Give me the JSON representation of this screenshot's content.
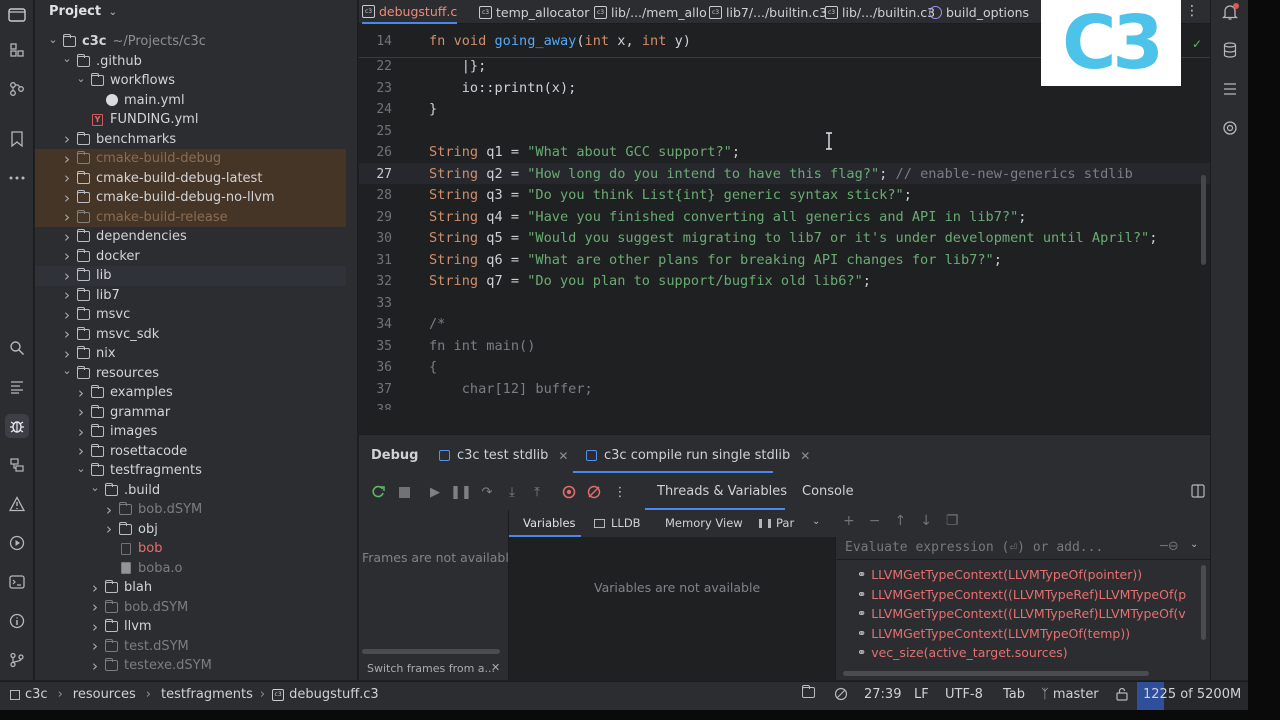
{
  "project_panel": {
    "title": "Project",
    "tree": [
      {
        "label": "c3c",
        "suffix": "~/Projects/c3c",
        "level": 0,
        "chev": "down",
        "icon": "folder"
      },
      {
        "label": ".github",
        "level": 1,
        "chev": "down",
        "icon": "folder"
      },
      {
        "label": "workflows",
        "level": 2,
        "chev": "down",
        "icon": "folder"
      },
      {
        "label": "main.yml",
        "level": 3,
        "chev": "none",
        "icon": "github"
      },
      {
        "label": "FUNDING.yml",
        "level": 2,
        "chev": "none",
        "icon": "yml"
      },
      {
        "label": "benchmarks",
        "level": 1,
        "chev": "right",
        "icon": "folder"
      },
      {
        "label": "cmake-build-debug",
        "level": 1,
        "chev": "right",
        "icon": "folder",
        "style": "excluded-dim"
      },
      {
        "label": "cmake-build-debug-latest",
        "level": 1,
        "chev": "right",
        "icon": "folder",
        "style": "excluded"
      },
      {
        "label": "cmake-build-debug-no-llvm",
        "level": 1,
        "chev": "right",
        "icon": "folder",
        "style": "excluded"
      },
      {
        "label": "cmake-build-release",
        "level": 1,
        "chev": "right",
        "icon": "folder",
        "style": "excluded-dim"
      },
      {
        "label": "dependencies",
        "level": 1,
        "chev": "right",
        "icon": "folder"
      },
      {
        "label": "docker",
        "level": 1,
        "chev": "right",
        "icon": "folder"
      },
      {
        "label": "lib",
        "level": 1,
        "chev": "right",
        "icon": "folder",
        "style": "selected"
      },
      {
        "label": "lib7",
        "level": 1,
        "chev": "right",
        "icon": "folder"
      },
      {
        "label": "msvc",
        "level": 1,
        "chev": "right",
        "icon": "folder"
      },
      {
        "label": "msvc_sdk",
        "level": 1,
        "chev": "right",
        "icon": "folder"
      },
      {
        "label": "nix",
        "level": 1,
        "chev": "right",
        "icon": "folder"
      },
      {
        "label": "resources",
        "level": 1,
        "chev": "down",
        "icon": "folder"
      },
      {
        "label": "examples",
        "level": 2,
        "chev": "right",
        "icon": "folder"
      },
      {
        "label": "grammar",
        "level": 2,
        "chev": "right",
        "icon": "folder"
      },
      {
        "label": "images",
        "level": 2,
        "chev": "right",
        "icon": "folder"
      },
      {
        "label": "rosettacode",
        "level": 2,
        "chev": "right",
        "icon": "folder"
      },
      {
        "label": "testfragments",
        "level": 2,
        "chev": "down",
        "icon": "folder"
      },
      {
        "label": ".build",
        "level": 3,
        "chev": "down",
        "icon": "folder"
      },
      {
        "label": "bob.dSYM",
        "level": 4,
        "chev": "right",
        "icon": "folder",
        "style": "dim"
      },
      {
        "label": "obj",
        "level": 4,
        "chev": "right",
        "icon": "folder"
      },
      {
        "label": "bob",
        "level": 4,
        "chev": "none",
        "icon": "binary",
        "style": "red"
      },
      {
        "label": "boba.o",
        "level": 4,
        "chev": "none",
        "icon": "file",
        "style": "dim"
      },
      {
        "label": "blah",
        "level": 3,
        "chev": "right",
        "icon": "folder"
      },
      {
        "label": "bob.dSYM",
        "level": 3,
        "chev": "right",
        "icon": "folder",
        "style": "dim"
      },
      {
        "label": "llvm",
        "level": 3,
        "chev": "right",
        "icon": "folder"
      },
      {
        "label": "test.dSYM",
        "level": 3,
        "chev": "right",
        "icon": "folder",
        "style": "dim"
      },
      {
        "label": "testexe.dSYM",
        "level": 3,
        "chev": "right",
        "icon": "folder",
        "style": "dim"
      }
    ]
  },
  "tabs": [
    {
      "label": "debugstuff.c",
      "active": true
    },
    {
      "label": "temp_allocator"
    },
    {
      "label": "lib/.../mem_allo"
    },
    {
      "label": "lib7/.../builtin.c3"
    },
    {
      "label": "lib/.../builtin.c3"
    },
    {
      "label": "build_options"
    }
  ],
  "editor": {
    "sticky": {
      "line": "14",
      "tokens": [
        [
          "kw",
          "fn "
        ],
        [
          "kw",
          "void "
        ],
        [
          "fn",
          "going_away"
        ],
        [
          "t",
          "("
        ],
        [
          "kw",
          "int "
        ],
        [
          "t",
          "x, "
        ],
        [
          "kw",
          "int "
        ],
        [
          "t",
          "y)"
        ]
      ]
    },
    "lines": [
      {
        "n": "22",
        "tokens": [
          [
            "t",
            "    |};"
          ]
        ]
      },
      {
        "n": "23",
        "tokens": [
          [
            "t",
            "    io::printn(x);"
          ]
        ]
      },
      {
        "n": "24",
        "tokens": [
          [
            "t",
            "}"
          ]
        ]
      },
      {
        "n": "25",
        "tokens": []
      },
      {
        "n": "26",
        "tokens": [
          [
            "kw",
            "String "
          ],
          [
            "t",
            "q1 = "
          ],
          [
            "str",
            "\"What about GCC support?\""
          ],
          [
            "t",
            ";"
          ]
        ]
      },
      {
        "n": "27",
        "current": true,
        "tokens": [
          [
            "kw",
            "String "
          ],
          [
            "t",
            "q2 = "
          ],
          [
            "str",
            "\"How long do you intend to have this flag?\""
          ],
          [
            "t",
            "; "
          ],
          [
            "cmt",
            "// enable-new-generics stdlib"
          ]
        ]
      },
      {
        "n": "28",
        "tokens": [
          [
            "kw",
            "String "
          ],
          [
            "t",
            "q3 = "
          ],
          [
            "str",
            "\"Do you think List{int} generic syntax stick?\""
          ],
          [
            "t",
            ";"
          ]
        ]
      },
      {
        "n": "29",
        "tokens": [
          [
            "kw",
            "String "
          ],
          [
            "t",
            "q4 = "
          ],
          [
            "str",
            "\"Have you finished converting all generics and API in lib7?\""
          ],
          [
            "t",
            ";"
          ]
        ]
      },
      {
        "n": "30",
        "tokens": [
          [
            "kw",
            "String "
          ],
          [
            "t",
            "q5 = "
          ],
          [
            "str",
            "\"Would you suggest migrating to lib7 or it's under development until April?\""
          ],
          [
            "t",
            ";"
          ]
        ]
      },
      {
        "n": "31",
        "tokens": [
          [
            "kw",
            "String "
          ],
          [
            "t",
            "q6 = "
          ],
          [
            "str",
            "\"What are other plans for breaking API changes for lib7?\""
          ],
          [
            "t",
            ";"
          ]
        ]
      },
      {
        "n": "32",
        "tokens": [
          [
            "kw",
            "String "
          ],
          [
            "t",
            "q7 = "
          ],
          [
            "str",
            "\"Do you plan to support/bugfix old lib6?\""
          ],
          [
            "t",
            ";"
          ]
        ]
      },
      {
        "n": "33",
        "tokens": []
      },
      {
        "n": "34",
        "tokens": [
          [
            "cmt",
            "/*"
          ]
        ]
      },
      {
        "n": "35",
        "tokens": [
          [
            "cmt",
            "fn int main()"
          ]
        ]
      },
      {
        "n": "36",
        "tokens": [
          [
            "cmt",
            "{"
          ]
        ]
      },
      {
        "n": "37",
        "tokens": [
          [
            "cmt",
            "    char[12] buffer;"
          ]
        ]
      },
      {
        "n": "38",
        "tokens": []
      }
    ]
  },
  "debug": {
    "title": "Debug",
    "configs": [
      {
        "label": "c3c test stdlib"
      },
      {
        "label": "c3c compile run single stdlib",
        "active": true
      }
    ],
    "view_tabs": {
      "threads": "Threads & Variables",
      "console": "Console"
    },
    "frames_empty": "Frames are not available",
    "switch_frames": "Switch frames from a...",
    "var_tabs": [
      "Variables",
      "LLDB",
      "Memory View",
      "Par"
    ],
    "vars_empty": "Variables are not available",
    "expr_placeholder": "Evaluate expression (⏎) or add...",
    "watches": [
      "LLVMGetTypeContext(LLVMTypeOf(pointer))",
      "LLVMGetTypeContext((LLVMTypeRef)LLVMTypeOf(p",
      "LLVMGetTypeContext((LLVMTypeRef)LLVMTypeOf(v",
      "LLVMGetTypeContext(LLVMTypeOf(temp))",
      "vec_size(active_target.sources)"
    ]
  },
  "status_bar": {
    "breadcrumbs": [
      "c3c",
      "resources",
      "testfragments",
      "debugstuff.c3"
    ],
    "position": "27:39",
    "line_sep": "LF",
    "encoding": "UTF-8",
    "indent": "Tab",
    "branch": "master",
    "memory": "1225 of 5200M"
  },
  "overlay_logo": "C3",
  "colors": {
    "accent": "#4a88f0",
    "string": "#6aab73",
    "keyword": "#cf8e6d",
    "function": "#56a8f5",
    "error": "#e86f6f",
    "logo": "#4ec3ea"
  }
}
